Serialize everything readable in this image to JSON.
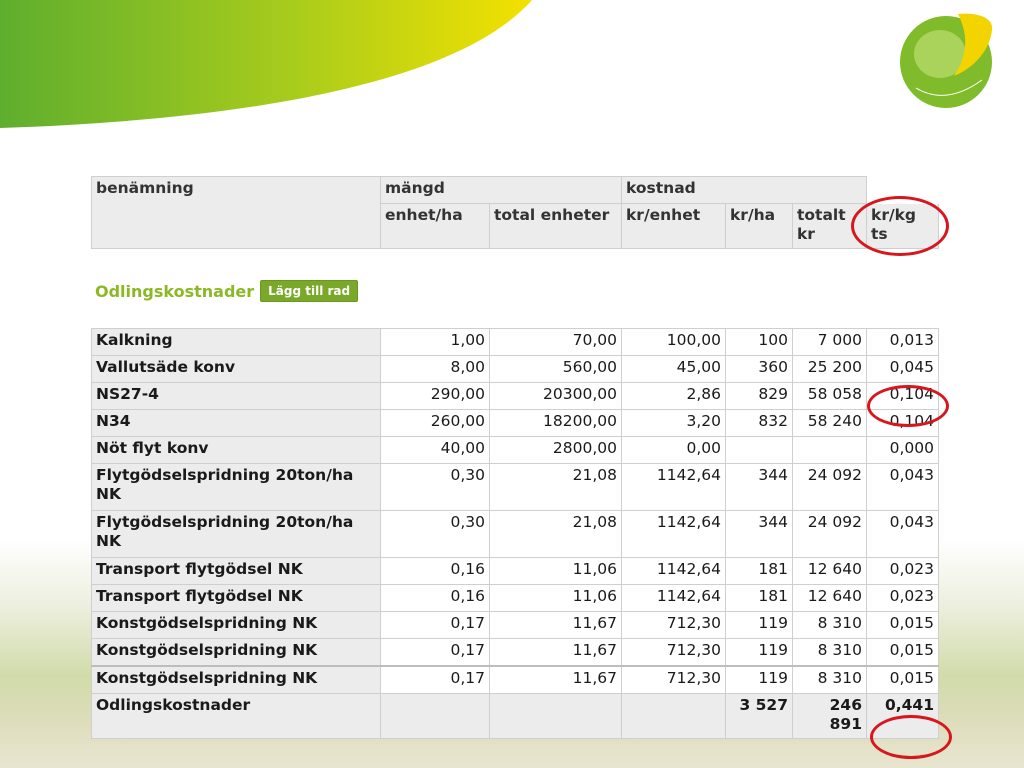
{
  "header": {
    "benamning": "benämning",
    "mangd": "mängd",
    "kostnad": "kostnad",
    "enhet_ha": "enhet/ha",
    "total_enheter": "total enheter",
    "kr_enhet": "kr/enhet",
    "kr_ha": "kr/ha",
    "totalt_kr": "totalt kr",
    "kr_kg_ts": "kr/kg ts"
  },
  "section": {
    "title": "Odlingskostnader",
    "add_button": "Lägg till rad"
  },
  "rows": [
    {
      "name": "Kalkning",
      "enhet_ha": "1,00",
      "total": "70,00",
      "kr_enhet": "100,00",
      "kr_ha": "100",
      "totalt": "7 000",
      "kr_kg": "0,013"
    },
    {
      "name": "Vallutsäde konv",
      "enhet_ha": "8,00",
      "total": "560,00",
      "kr_enhet": "45,00",
      "kr_ha": "360",
      "totalt": "25 200",
      "kr_kg": "0,045"
    },
    {
      "name": "NS27-4",
      "enhet_ha": "290,00",
      "total": "20300,00",
      "kr_enhet": "2,86",
      "kr_ha": "829",
      "totalt": "58 058",
      "kr_kg": "0,104"
    },
    {
      "name": "N34",
      "enhet_ha": "260,00",
      "total": "18200,00",
      "kr_enhet": "3,20",
      "kr_ha": "832",
      "totalt": "58 240",
      "kr_kg": "0,104"
    },
    {
      "name": "Nöt flyt konv",
      "enhet_ha": "40,00",
      "total": "2800,00",
      "kr_enhet": "0,00",
      "kr_ha": "",
      "totalt": "",
      "kr_kg": "0,000"
    },
    {
      "name": "Flytgödselspridning 20ton/ha NK",
      "enhet_ha": "0,30",
      "total": "21,08",
      "kr_enhet": "1142,64",
      "kr_ha": "344",
      "totalt": "24 092",
      "kr_kg": "0,043"
    },
    {
      "name": "Flytgödselspridning 20ton/ha NK",
      "enhet_ha": "0,30",
      "total": "21,08",
      "kr_enhet": "1142,64",
      "kr_ha": "344",
      "totalt": "24 092",
      "kr_kg": "0,043"
    },
    {
      "name": "Transport flytgödsel NK",
      "enhet_ha": "0,16",
      "total": "11,06",
      "kr_enhet": "1142,64",
      "kr_ha": "181",
      "totalt": "12 640",
      "kr_kg": "0,023"
    },
    {
      "name": "Transport flytgödsel NK",
      "enhet_ha": "0,16",
      "total": "11,06",
      "kr_enhet": "1142,64",
      "kr_ha": "181",
      "totalt": "12 640",
      "kr_kg": "0,023"
    },
    {
      "name": "Konstgödselspridning NK",
      "enhet_ha": "0,17",
      "total": "11,67",
      "kr_enhet": "712,30",
      "kr_ha": "119",
      "totalt": "8 310",
      "kr_kg": "0,015"
    },
    {
      "name": "Konstgödselspridning NK",
      "enhet_ha": "0,17",
      "total": "11,67",
      "kr_enhet": "712,30",
      "kr_ha": "119",
      "totalt": "8 310",
      "kr_kg": "0,015"
    },
    {
      "name": "Konstgödselspridning NK",
      "enhet_ha": "0,17",
      "total": "11,67",
      "kr_enhet": "712,30",
      "kr_ha": "119",
      "totalt": "8 310",
      "kr_kg": "0,015"
    }
  ],
  "total_row": {
    "name": "Odlingskostnader",
    "kr_ha": "3 527",
    "totalt": "246 891",
    "kr_kg": "0,441"
  },
  "colors": {
    "accent_green": "#8bb825",
    "button_green": "#7aa92a",
    "highlight_red": "#d6171e",
    "header_grey": "#ececec"
  }
}
